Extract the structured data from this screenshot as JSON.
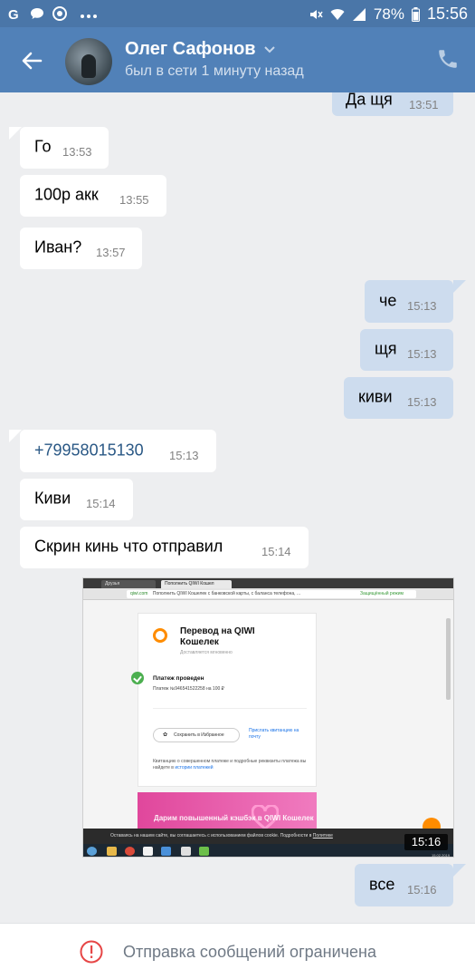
{
  "status_bar": {
    "battery": "78%",
    "time": "15:56",
    "left_icons": [
      "g-icon",
      "chat-icon",
      "chrome-icon",
      "more-dots-icon"
    ],
    "right_icons": [
      "mute-icon",
      "wifi-icon",
      "signal-icon",
      "battery-icon"
    ]
  },
  "header": {
    "contact_name": "Олег Сафонов",
    "contact_status": "был в сети 1 минуту назад",
    "colors": {
      "bar": "#5181b8",
      "status_bar": "#4a76a8"
    }
  },
  "messages": [
    {
      "dir": "out",
      "text": "Да щя",
      "time": "13:51",
      "partial": true
    },
    {
      "dir": "in",
      "text": "Го",
      "time": "13:53"
    },
    {
      "dir": "in",
      "text": "100р акк",
      "time": "13:55"
    },
    {
      "dir": "in",
      "text": "Иван?",
      "time": "13:57"
    },
    {
      "dir": "out",
      "text": "че",
      "time": "15:13"
    },
    {
      "dir": "out",
      "text": "щя",
      "time": "15:13"
    },
    {
      "dir": "out",
      "text": "киви",
      "time": "15:13"
    },
    {
      "dir": "in",
      "text": "+79958015130",
      "time": "15:13",
      "link": true
    },
    {
      "dir": "in",
      "text": "Киви",
      "time": "15:14"
    },
    {
      "dir": "in",
      "text": "Скрин кинь что отправил",
      "time": "15:14"
    },
    {
      "dir": "out",
      "text": "все",
      "time": "15:16"
    }
  ],
  "attachment": {
    "tab_1": "Друзья",
    "tab_2": "Пополнить QIWI Кошел",
    "url_host": "qiwi.com",
    "url_title": "Пополнить QIWI Кошелек с банковской карты, с баланса телефона, ...",
    "secure_label": "Защищённый режим",
    "card_title": "Перевод на QIWI Кошелек",
    "card_subtitle": "Доставляется мгновенно",
    "status": "Платеж проведен",
    "payment_line": "Платеж №946541522258 на 100 ₽",
    "save_button": "Сохранить в Избранное",
    "send_receipt": "Прислать квитанцию на почту",
    "note_text": "Квитанцию о совершенном платеже и подробные реквизиты платежа вы найдете в",
    "note_link": "истории платежей",
    "promo": "Дарим повышенный кэшбэк в QIWI Кошелек",
    "cookie_text": "Оставаясь на нашем сайте, вы соглашаетесь с использованием файлов cookie. Подробности в",
    "cookie_link": "Политике",
    "overlay_time": "15:16",
    "taskbar_date": "15.02.2019"
  },
  "footer": {
    "text": "Отправка сообщений ограничена",
    "icon": "alert-circle-icon",
    "icon_color": "#e64646"
  }
}
